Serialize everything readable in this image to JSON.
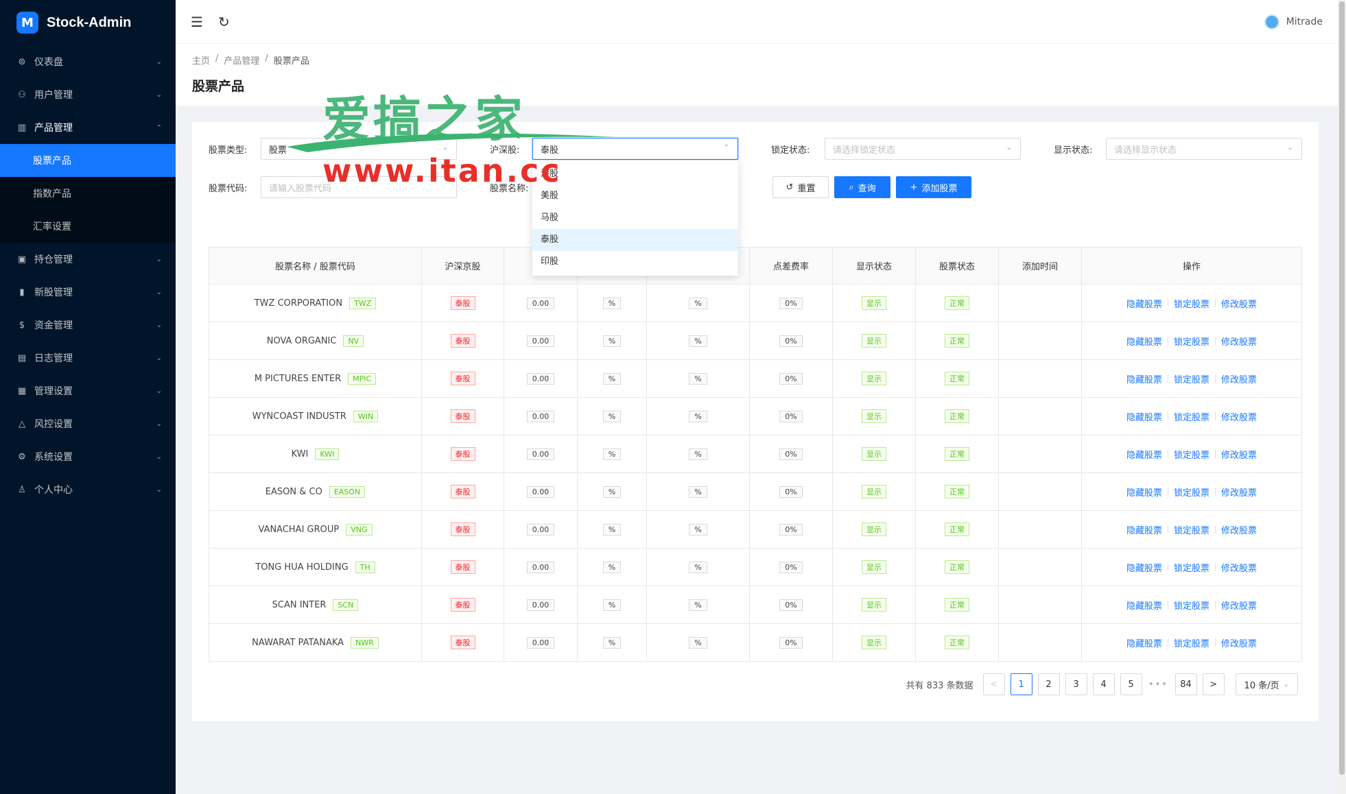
{
  "app": {
    "title": "Stock-Admin",
    "logo_mark": "M"
  },
  "sidebar": {
    "items": [
      {
        "label": "仪表盘",
        "icon": "dashboard-icon",
        "glyph": "⊚",
        "arrow": "⌄"
      },
      {
        "label": "用户管理",
        "icon": "users-icon",
        "glyph": "⚇",
        "arrow": "⌄"
      },
      {
        "label": "产品管理",
        "icon": "chart-icon",
        "glyph": "▥",
        "arrow": "⌃",
        "open": true
      },
      {
        "label": "持仓管理",
        "icon": "position-icon",
        "glyph": "▣",
        "arrow": "⌄"
      },
      {
        "label": "新股管理",
        "icon": "ipo-icon",
        "glyph": "▮",
        "arrow": "⌄"
      },
      {
        "label": "资金管理",
        "icon": "money-icon",
        "glyph": "$",
        "arrow": "⌄"
      },
      {
        "label": "日志管理",
        "icon": "log-icon",
        "glyph": "▤",
        "arrow": "⌄"
      },
      {
        "label": "管理设置",
        "icon": "admin-settings-icon",
        "glyph": "▦",
        "arrow": "⌄"
      },
      {
        "label": "风控设置",
        "icon": "warning-icon",
        "glyph": "△",
        "arrow": "⌄"
      },
      {
        "label": "系统设置",
        "icon": "gear-icon",
        "glyph": "⚙",
        "arrow": "⌄"
      },
      {
        "label": "个人中心",
        "icon": "user-icon",
        "glyph": "♙",
        "arrow": "⌄"
      }
    ],
    "subitems": [
      "股票产品",
      "指数产品",
      "汇率设置"
    ]
  },
  "header": {
    "menu_glyph": "☰",
    "refresh_glyph": "↻",
    "username": "Mitrade"
  },
  "breadcrumb": [
    "主页",
    "产品管理",
    "股票产品"
  ],
  "breadcrumb_sep": "/",
  "page_title": "股票产品",
  "filters": {
    "stock_type": {
      "label": "股票类型:",
      "value": "股票"
    },
    "market": {
      "label": "沪深股:",
      "value": "泰股"
    },
    "lock_status": {
      "label": "锁定状态:",
      "placeholder": "请选择锁定状态"
    },
    "display_status": {
      "label": "显示状态:",
      "placeholder": "请选择显示状态"
    },
    "stock_code": {
      "label": "股票代码:",
      "placeholder": "请输入股票代码"
    },
    "stock_name": {
      "label": "股票名称:"
    },
    "caret_down": "⌄",
    "caret_up": "⌃"
  },
  "buttons": {
    "reset": "重置",
    "query": "查询",
    "add": "添加股票",
    "reset_glyph": "↺",
    "query_glyph": "⌕",
    "add_glyph": "+"
  },
  "dropdown": {
    "options": [
      "港股",
      "美股",
      "马股",
      "泰股",
      "印股"
    ],
    "selected": "泰股"
  },
  "table": {
    "headers": [
      "股票名称 / 股票代码",
      "沪深京股",
      "",
      "",
      "",
      "点差费率",
      "显示状态",
      "股票状态",
      "添加时间",
      "操作"
    ],
    "rows": [
      {
        "name": "TWZ CORPORATION",
        "code": "TWZ",
        "market": "泰股",
        "v1": "0.00",
        "v2": "%",
        "v3": "%",
        "spread": "0%",
        "display": "显示",
        "status": "正常",
        "time": ""
      },
      {
        "name": "NOVA ORGANIC",
        "code": "NV",
        "market": "泰股",
        "v1": "0.00",
        "v2": "%",
        "v3": "%",
        "spread": "0%",
        "display": "显示",
        "status": "正常",
        "time": ""
      },
      {
        "name": "M PICTURES ENTER",
        "code": "MPIC",
        "market": "泰股",
        "v1": "0.00",
        "v2": "%",
        "v3": "%",
        "spread": "0%",
        "display": "显示",
        "status": "正常",
        "time": ""
      },
      {
        "name": "WYNCOAST INDUSTR",
        "code": "WIN",
        "market": "泰股",
        "v1": "0.00",
        "v2": "%",
        "v3": "%",
        "spread": "0%",
        "display": "显示",
        "status": "正常",
        "time": ""
      },
      {
        "name": "KWI",
        "code": "KWI",
        "market": "泰股",
        "v1": "0.00",
        "v2": "%",
        "v3": "%",
        "spread": "0%",
        "display": "显示",
        "status": "正常",
        "time": ""
      },
      {
        "name": "EASON & CO",
        "code": "EASON",
        "market": "泰股",
        "v1": "0.00",
        "v2": "%",
        "v3": "%",
        "spread": "0%",
        "display": "显示",
        "status": "正常",
        "time": ""
      },
      {
        "name": "VANACHAI GROUP",
        "code": "VNG",
        "market": "泰股",
        "v1": "0.00",
        "v2": "%",
        "v3": "%",
        "spread": "0%",
        "display": "显示",
        "status": "正常",
        "time": ""
      },
      {
        "name": "TONG HUA HOLDING",
        "code": "TH",
        "market": "泰股",
        "v1": "0.00",
        "v2": "%",
        "v3": "%",
        "spread": "0%",
        "display": "显示",
        "status": "正常",
        "time": ""
      },
      {
        "name": "SCAN INTER",
        "code": "SCN",
        "market": "泰股",
        "v1": "0.00",
        "v2": "%",
        "v3": "%",
        "spread": "0%",
        "display": "显示",
        "status": "正常",
        "time": ""
      },
      {
        "name": "NAWARAT PATANAKA",
        "code": "NWR",
        "market": "泰股",
        "v1": "0.00",
        "v2": "%",
        "v3": "%",
        "spread": "0%",
        "display": "显示",
        "status": "正常",
        "time": ""
      }
    ],
    "actions": [
      "隐藏股票",
      "锁定股票",
      "修改股票"
    ]
  },
  "pagination": {
    "total": "共有 833 条数据",
    "prev": "<",
    "next": ">",
    "pages": [
      "1",
      "2",
      "3",
      "4",
      "5"
    ],
    "ellipsis": "•••",
    "last": "84",
    "current": "1",
    "page_size": "10 条/页",
    "page_size_caret": "⌄"
  },
  "watermark": {
    "top": "爱搞之家",
    "bottom": "www.itan.cc"
  },
  "colors": {
    "sidebar_bg": "#001529",
    "primary": "#1677ff",
    "danger": "#f5222d",
    "success": "#52c41a"
  }
}
